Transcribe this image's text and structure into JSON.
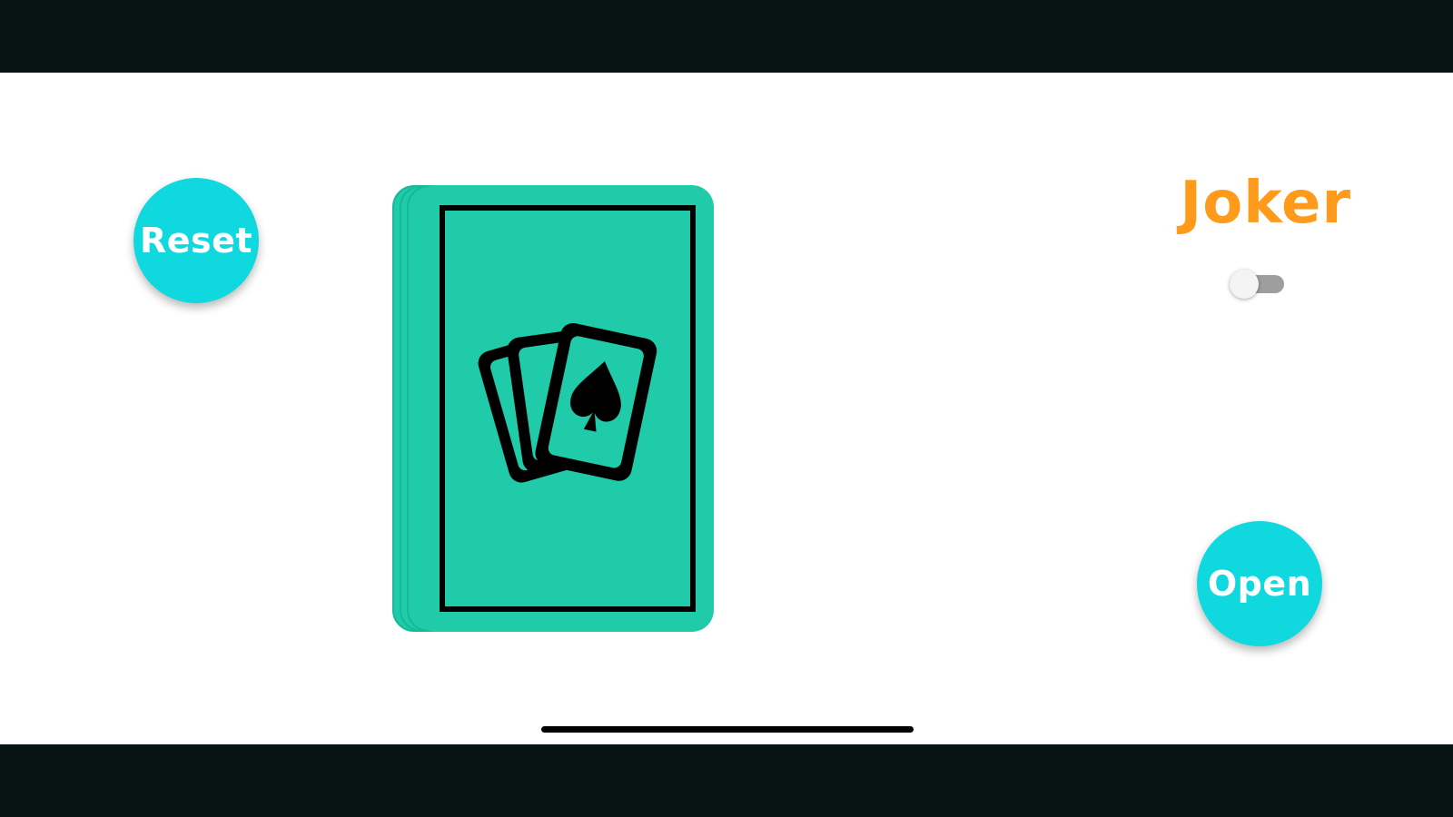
{
  "buttons": {
    "reset_label": "Reset",
    "open_label": "Open"
  },
  "joker": {
    "label": "Joker",
    "toggle_on": false
  },
  "deck": {
    "icon": "playing-cards-spade-icon"
  },
  "colors": {
    "button_bg": "#10d8df",
    "button_text": "#ffffff",
    "card_green": "#1fcba8",
    "joker_orange": "#ff9a1a",
    "letterbox": "#081412",
    "toggle_track": "#9e9e9e"
  }
}
